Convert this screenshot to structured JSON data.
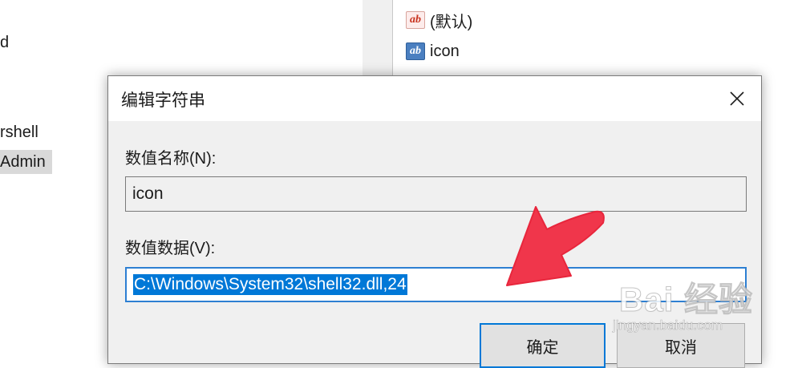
{
  "tree": {
    "items": [
      {
        "label": "d"
      },
      {
        "label": "rshell"
      },
      {
        "label": "Admin",
        "selected": true
      }
    ]
  },
  "values_list": {
    "rows": [
      {
        "icon": "string-value-icon",
        "label": "(默认)"
      },
      {
        "icon": "string-value-icon",
        "label": "icon"
      }
    ]
  },
  "dialog": {
    "title": "编辑字符串",
    "close_glyph": "✕",
    "value_name_label": "数值名称(N):",
    "value_name": "icon",
    "value_data_label": "数值数据(V):",
    "value_data": "C:\\Windows\\System32\\shell32.dll,24",
    "ok_label": "确定",
    "cancel_label": "取消"
  },
  "annotation": {
    "color": "#f0364b"
  },
  "watermark": {
    "logo": "Bai 经验",
    "url": "jingyan.baidu.com"
  }
}
